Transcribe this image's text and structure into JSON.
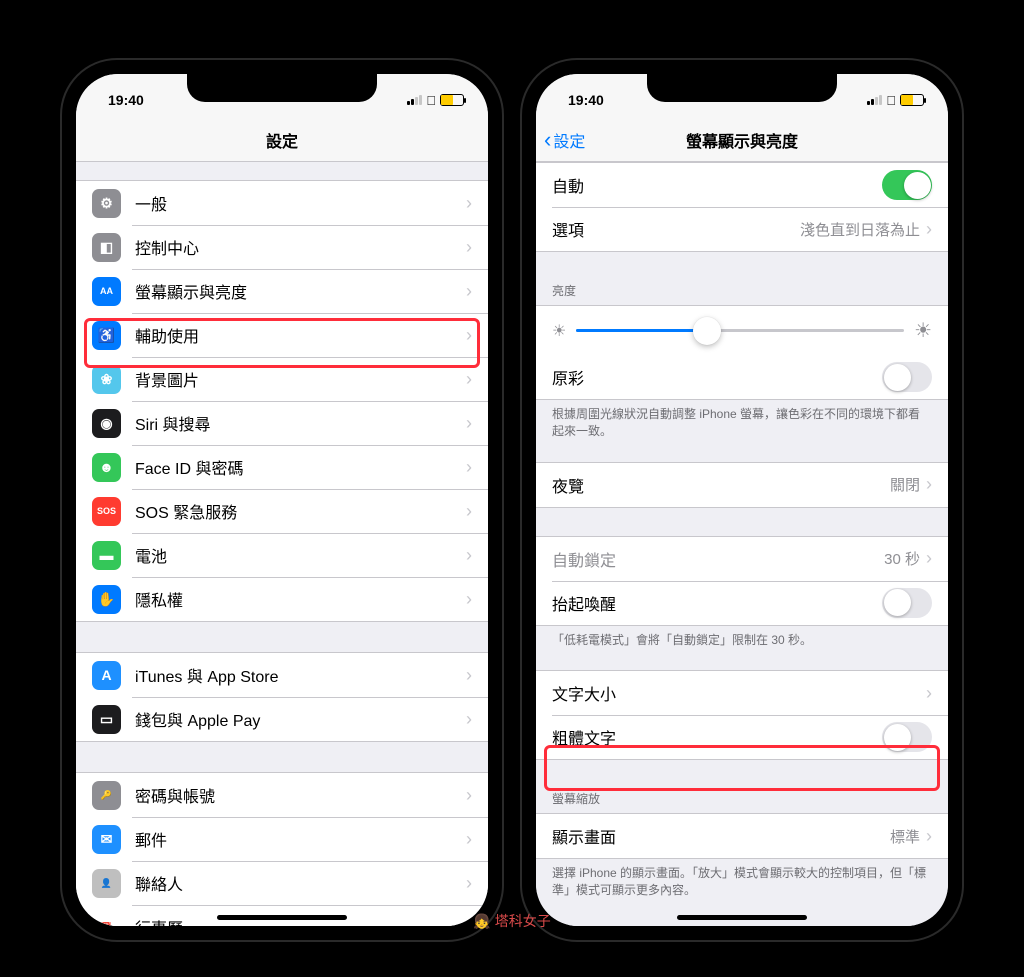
{
  "status": {
    "time": "19:40"
  },
  "left": {
    "title": "設定",
    "groups": [
      {
        "items": [
          {
            "id": "general",
            "label": "一般",
            "iconBg": "#8e8e93",
            "iconGlyph": "⚙"
          },
          {
            "id": "control-center",
            "label": "控制中心",
            "iconBg": "#8e8e93",
            "iconGlyph": "◧"
          },
          {
            "id": "display",
            "label": "螢幕顯示與亮度",
            "iconBg": "#007aff",
            "iconGlyph": "AA",
            "highlighted": true
          },
          {
            "id": "accessibility",
            "label": "輔助使用",
            "iconBg": "#007aff",
            "iconGlyph": "♿"
          },
          {
            "id": "wallpaper",
            "label": "背景圖片",
            "iconBg": "#54c7ec",
            "iconGlyph": "❀"
          },
          {
            "id": "siri",
            "label": "Siri 與搜尋",
            "iconBg": "#1c1c1e",
            "iconGlyph": "◉"
          },
          {
            "id": "faceid",
            "label": "Face ID 與密碼",
            "iconBg": "#34c759",
            "iconGlyph": "☻"
          },
          {
            "id": "sos",
            "label": "SOS 緊急服務",
            "iconBg": "#ff3b30",
            "iconGlyph": "SOS"
          },
          {
            "id": "battery",
            "label": "電池",
            "iconBg": "#34c759",
            "iconGlyph": "▬"
          },
          {
            "id": "privacy",
            "label": "隱私權",
            "iconBg": "#007aff",
            "iconGlyph": "✋"
          }
        ]
      },
      {
        "items": [
          {
            "id": "itunes",
            "label": "iTunes 與 App Store",
            "iconBg": "#1e90ff",
            "iconGlyph": "A"
          },
          {
            "id": "wallet",
            "label": "錢包與 Apple Pay",
            "iconBg": "#1c1c1e",
            "iconGlyph": "▭"
          }
        ]
      },
      {
        "items": [
          {
            "id": "passwords",
            "label": "密碼與帳號",
            "iconBg": "#8e8e93",
            "iconGlyph": "🔑"
          },
          {
            "id": "mail",
            "label": "郵件",
            "iconBg": "#1e90ff",
            "iconGlyph": "✉"
          },
          {
            "id": "contacts",
            "label": "聯絡人",
            "iconBg": "#bfbfbf",
            "iconGlyph": "👤"
          },
          {
            "id": "calendar",
            "label": "行事曆",
            "iconBg": "#ffffff",
            "iconGlyph": "📅"
          }
        ]
      }
    ]
  },
  "right": {
    "back": "設定",
    "title": "螢幕顯示與亮度",
    "auto": {
      "label": "自動",
      "on": true
    },
    "options": {
      "label": "選項",
      "value": "淺色直到日落為止"
    },
    "brightness": {
      "header": "亮度"
    },
    "truetone": {
      "label": "原彩",
      "on": false
    },
    "truetoneFooter": "根據周圍光線狀況自動調整 iPhone 螢幕，讓色彩在不同的環境下都看起來一致。",
    "nightshift": {
      "label": "夜覽",
      "value": "關閉"
    },
    "autolock": {
      "label": "自動鎖定",
      "value": "30 秒",
      "disabled": true
    },
    "raise": {
      "label": "抬起喚醒",
      "on": false
    },
    "raiseFooter": "「低耗電模式」會將「自動鎖定」限制在 30 秒。",
    "textsize": {
      "label": "文字大小"
    },
    "bold": {
      "label": "粗體文字",
      "on": false,
      "highlighted": true
    },
    "zoom": {
      "header": "螢幕縮放",
      "label": "顯示畫面",
      "value": "標準"
    },
    "zoomFooter": "選擇 iPhone 的顯示畫面。「放大」模式會顯示較大的控制項目，但「標準」模式可顯示更多內容。"
  },
  "watermark": "塔科女子"
}
